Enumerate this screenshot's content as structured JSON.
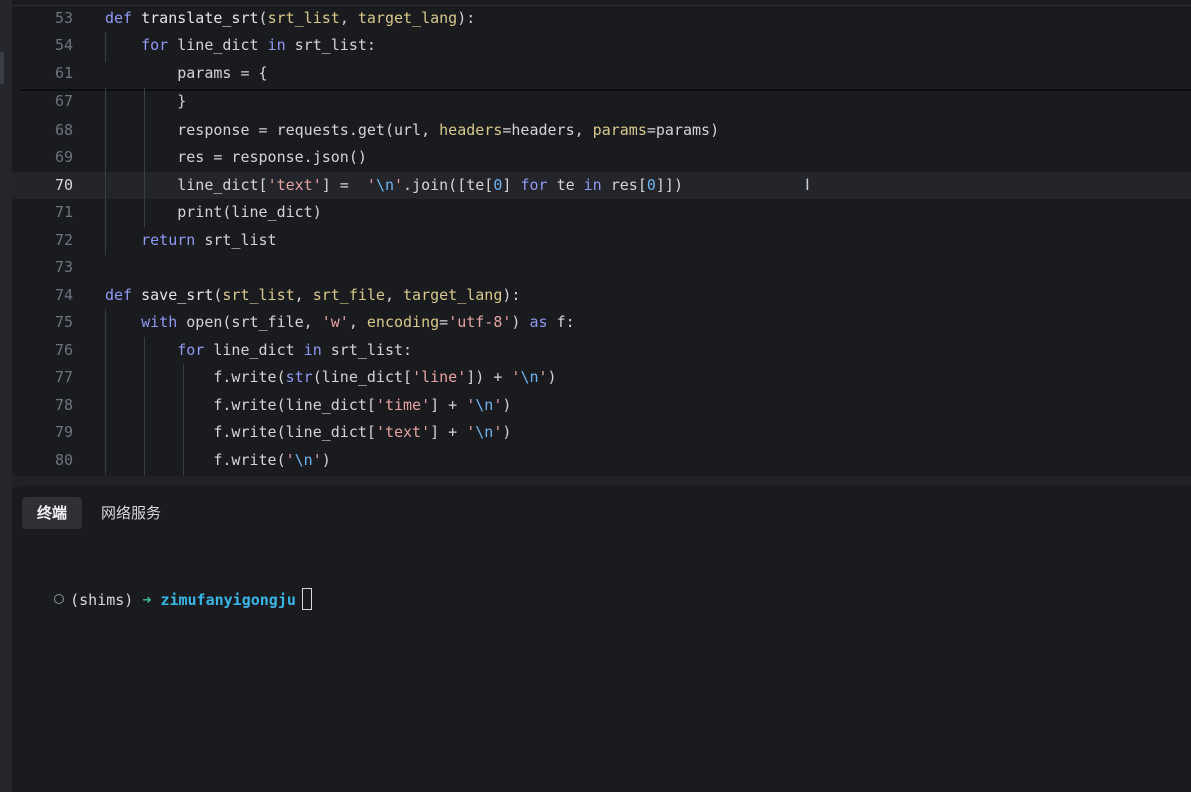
{
  "editor": {
    "lines": [
      {
        "num": "53",
        "tokens": [
          [
            "kw",
            "def "
          ],
          [
            "fn",
            "translate_srt"
          ],
          [
            "",
            "("
          ],
          [
            "pm",
            "srt_list"
          ],
          [
            "",
            ", "
          ],
          [
            "pm",
            "target_lang"
          ],
          [
            "",
            "):"
          ]
        ]
      },
      {
        "num": "54",
        "tokens": [
          [
            "",
            "    "
          ],
          [
            "kw",
            "for "
          ],
          [
            "",
            "line_dict "
          ],
          [
            "kw",
            "in "
          ],
          [
            "",
            "srt_list:"
          ]
        ]
      },
      {
        "num": "61",
        "tokens": [
          [
            "",
            "        params = {"
          ]
        ]
      },
      {
        "num": "67",
        "tokens": [
          [
            "",
            "        }"
          ]
        ]
      },
      {
        "num": "68",
        "tokens": [
          [
            "",
            "        response = requests.get(url, "
          ],
          [
            "pm",
            "headers"
          ],
          [
            "",
            "=headers, "
          ],
          [
            "pm",
            "params"
          ],
          [
            "",
            "=params)"
          ]
        ]
      },
      {
        "num": "69",
        "tokens": [
          [
            "",
            "        res = response.json()"
          ]
        ]
      },
      {
        "num": "70",
        "tokens": [
          [
            "",
            "        line_dict["
          ],
          [
            "st",
            "'text'"
          ],
          [
            "",
            "] =  "
          ],
          [
            "st",
            "'"
          ],
          [
            "es",
            "\\n"
          ],
          [
            "st",
            "'"
          ],
          [
            "",
            ".join([te["
          ],
          [
            "nm",
            "0"
          ],
          [
            "",
            "] "
          ],
          [
            "kw",
            "for "
          ],
          [
            "",
            "te "
          ],
          [
            "kw",
            "in "
          ],
          [
            "",
            "res["
          ],
          [
            "nm",
            "0"
          ],
          [
            "",
            "]])"
          ]
        ]
      },
      {
        "num": "71",
        "tokens": [
          [
            "",
            "        print(line_dict)"
          ]
        ]
      },
      {
        "num": "72",
        "tokens": [
          [
            "",
            "    "
          ],
          [
            "kw",
            "return "
          ],
          [
            "",
            "srt_list"
          ]
        ]
      },
      {
        "num": "73",
        "tokens": []
      },
      {
        "num": "74",
        "tokens": [
          [
            "kw",
            "def "
          ],
          [
            "fn",
            "save_srt"
          ],
          [
            "",
            "("
          ],
          [
            "pm",
            "srt_list"
          ],
          [
            "",
            ", "
          ],
          [
            "pm",
            "srt_file"
          ],
          [
            "",
            ", "
          ],
          [
            "pm",
            "target_lang"
          ],
          [
            "",
            "):"
          ]
        ]
      },
      {
        "num": "75",
        "tokens": [
          [
            "",
            "    "
          ],
          [
            "kw",
            "with "
          ],
          [
            "",
            "open(srt_file, "
          ],
          [
            "st",
            "'w'"
          ],
          [
            "",
            ", "
          ],
          [
            "pm",
            "encoding"
          ],
          [
            "",
            "="
          ],
          [
            "st",
            "'utf-8'"
          ],
          [
            "",
            ") "
          ],
          [
            "kw",
            "as "
          ],
          [
            "",
            "f:"
          ]
        ]
      },
      {
        "num": "76",
        "tokens": [
          [
            "",
            "        "
          ],
          [
            "kw",
            "for "
          ],
          [
            "",
            "line_dict "
          ],
          [
            "kw",
            "in "
          ],
          [
            "",
            "srt_list:"
          ]
        ]
      },
      {
        "num": "77",
        "tokens": [
          [
            "",
            "            f.write("
          ],
          [
            "kw",
            "str"
          ],
          [
            "",
            "(line_dict["
          ],
          [
            "st",
            "'line'"
          ],
          [
            "",
            "]) + "
          ],
          [
            "st",
            "'"
          ],
          [
            "es",
            "\\n"
          ],
          [
            "st",
            "'"
          ],
          [
            "",
            ")"
          ]
        ]
      },
      {
        "num": "78",
        "tokens": [
          [
            "",
            "            f.write(line_dict["
          ],
          [
            "st",
            "'time'"
          ],
          [
            "",
            "] + "
          ],
          [
            "st",
            "'"
          ],
          [
            "es",
            "\\n"
          ],
          [
            "st",
            "'"
          ],
          [
            "",
            ")"
          ]
        ]
      },
      {
        "num": "79",
        "tokens": [
          [
            "",
            "            f.write(line_dict["
          ],
          [
            "st",
            "'text'"
          ],
          [
            "",
            "] + "
          ],
          [
            "st",
            "'"
          ],
          [
            "es",
            "\\n"
          ],
          [
            "st",
            "'"
          ],
          [
            "",
            ")"
          ]
        ]
      },
      {
        "num": "80",
        "tokens": [
          [
            "",
            "            f.write("
          ],
          [
            "st",
            "'"
          ],
          [
            "es",
            "\\n"
          ],
          [
            "st",
            "'"
          ],
          [
            "",
            ")"
          ]
        ]
      }
    ],
    "active_line": "70"
  },
  "terminal": {
    "tabs": [
      {
        "label": "终端",
        "active": true
      },
      {
        "label": "网络服务",
        "active": false
      }
    ],
    "prompt": {
      "env": "(shims)",
      "arrow": "➜",
      "cwd": "zimufanyigongju"
    }
  }
}
